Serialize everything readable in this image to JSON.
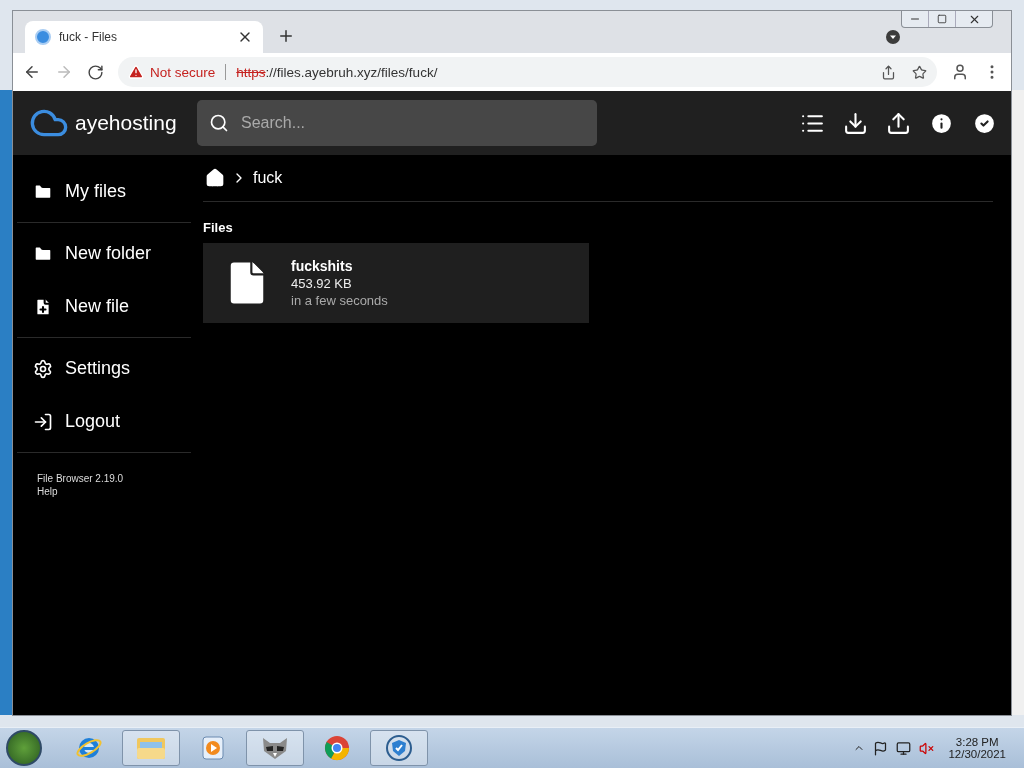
{
  "browser": {
    "tab": {
      "title": "fuck - Files"
    },
    "address": {
      "warning": "Not secure",
      "scheme": "https",
      "rest": "://files.ayebruh.xyz/files/fuck/"
    }
  },
  "header": {
    "brand": "ayehosting",
    "search": {
      "placeholder": "Search..."
    }
  },
  "sidebar": {
    "groups": [
      [
        {
          "label": "My files",
          "kind": "folder"
        }
      ],
      [
        {
          "label": "New folder",
          "kind": "new-folder"
        },
        {
          "label": "New file",
          "kind": "new-file"
        }
      ],
      [
        {
          "label": "Settings",
          "kind": "settings"
        },
        {
          "label": "Logout",
          "kind": "logout"
        }
      ]
    ],
    "footer": [
      "File Browser 2.19.0",
      "Help"
    ]
  },
  "breadcrumb": [
    "fuck"
  ],
  "section": "Files",
  "files": [
    {
      "name": "fuckshits",
      "size": "453.92 KB",
      "modified": "in a few seconds"
    }
  ],
  "taskbar": {
    "apps": [
      {
        "kind": "ie",
        "open": false
      },
      {
        "kind": "explorer",
        "open": true
      },
      {
        "kind": "media",
        "open": false
      },
      {
        "kind": "raccoon",
        "open": true
      },
      {
        "kind": "chrome",
        "open": false
      },
      {
        "kind": "shield",
        "open": true
      }
    ],
    "time": "3:28 PM",
    "date": "12/30/2021"
  }
}
